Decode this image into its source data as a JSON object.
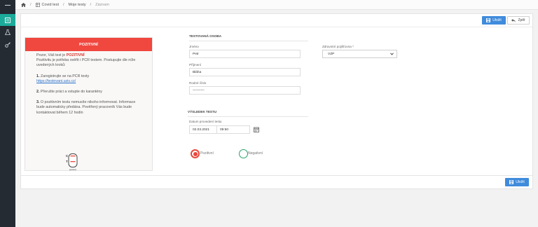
{
  "breadcrumb": {
    "home_icon": "home-icon",
    "item1": "Covid test",
    "item2": "Moje testy",
    "item3": "Záznam"
  },
  "toolbar": {
    "save_label": "Uložit",
    "back_label": "Zpět"
  },
  "info": {
    "header": "POZITIVNÍ",
    "p1_prefix": "Pozor, Váš test je ",
    "p1_strong": "POZITIVNÍ",
    "p1_rest": "Pozitivitu je potřeba ověřit i PCR testem. Postupujte dle níže uvedených kroků:",
    "step1_num": "1.",
    "step1_text": "Zaregistrujte se na PCR testy",
    "step1_link": "https://testovani.uzis.cz/",
    "step2_num": "2.",
    "step2_text": "Přerušte práci a vstupte do karantény",
    "step3_num": "3.",
    "step3_text": "O pozitivním testu nemusíte nikoho informovat. Informace bude automaticky předána. Pověřený pracovník Vás bude kontaktovat během 12 hodin",
    "illustration": {
      "c": "C",
      "t": "T",
      "caption": "pozitivní"
    }
  },
  "person": {
    "section_title": "TESTOVANÁ OSOBA",
    "first_name_label": "Jméno",
    "first_name_value": "Petr",
    "last_name_label": "Příjmení",
    "last_name_value": "Bláha",
    "birth_label": "Rodné číslo",
    "birth_value": "••••••••••",
    "insurance_label": "Zdravotní pojišťovna *",
    "insurance_value": "VZP"
  },
  "result": {
    "section_title": "VÝSLEDEK TESTU",
    "date_label": "Datum provedení testu",
    "date_value": "02.03.2021",
    "time_value": "09:50",
    "positive_label": "Pozitivní",
    "negative_label": "Negativní"
  },
  "colors": {
    "sidebar": "#252b33",
    "accent": "#1bab9a",
    "primary": "#3f8bdc",
    "danger": "#f0473f",
    "success": "#2aa26a"
  }
}
